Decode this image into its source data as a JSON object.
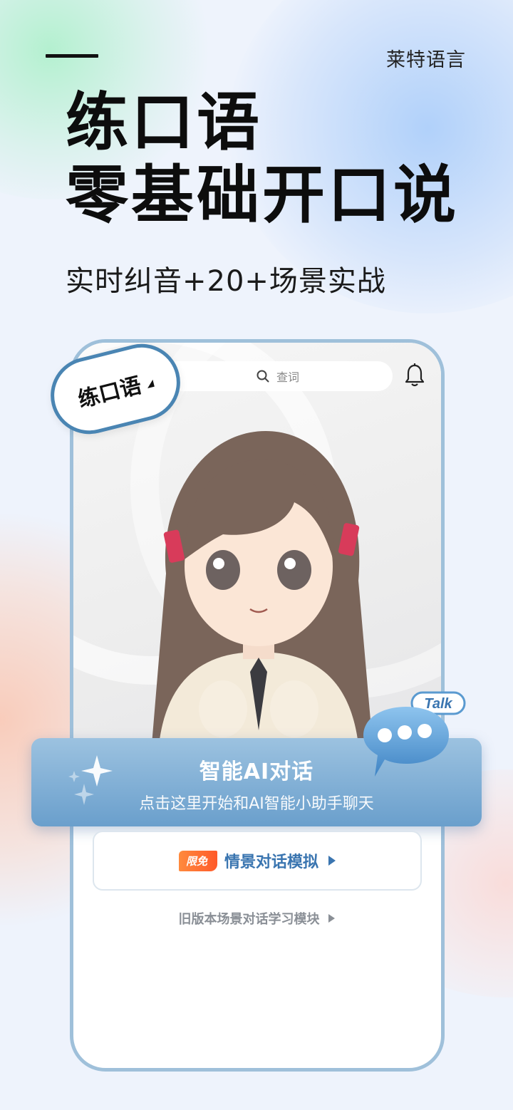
{
  "brand": "莱特语言",
  "headline": {
    "line1": "练口语",
    "line2": "零基础开口说"
  },
  "subheadline": "实时纠音+20+场景实战",
  "app": {
    "tab_label": "练口语",
    "search_placeholder": "查词",
    "ai_chat": {
      "title": "智能AI对话",
      "subtitle": "点击这里开始和AI智能小助手聊天",
      "bubble_label": "Talk"
    },
    "scene_button": {
      "badge": "限免",
      "label": "情景对话模拟"
    },
    "legacy_link": "旧版本场景对话学习模块"
  },
  "colors": {
    "accent_blue": "#3a75b0",
    "banner_blue": "#6a9fcc",
    "badge_orange": "#ff6a2f",
    "frame_blue": "#9fc0da"
  },
  "icons": [
    "search-icon",
    "bell-icon",
    "sparkle-icon",
    "chat-bubble-icon",
    "play-triangle-icon"
  ]
}
